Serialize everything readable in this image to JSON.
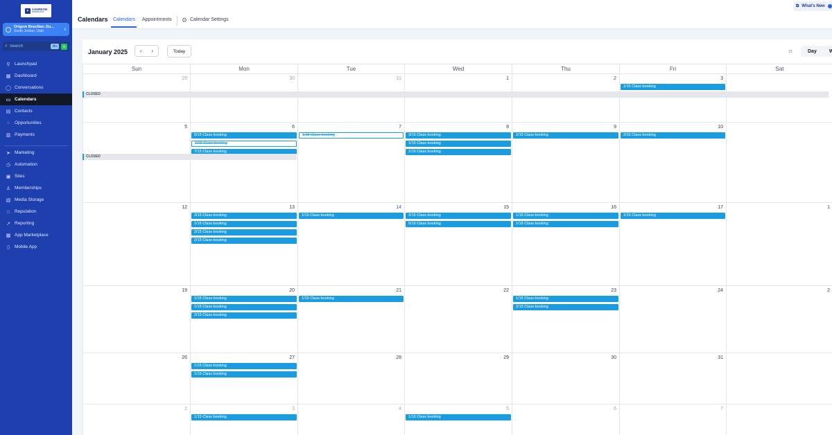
{
  "brand": {
    "logo_text": "AZUREON",
    "logo_sub": "MARKETING"
  },
  "location": {
    "name": "Origem Brazilian Jiu...",
    "city": "South Jordan, Utah"
  },
  "search": {
    "placeholder": "Search",
    "shortcut": "⌘K"
  },
  "nav_primary": [
    {
      "label": "Launchpad",
      "icon": "rocket-icon",
      "glyph": "⚲"
    },
    {
      "label": "Dashboard",
      "icon": "dashboard-icon",
      "glyph": "▦"
    },
    {
      "label": "Conversations",
      "icon": "chat-icon",
      "glyph": "◯"
    },
    {
      "label": "Calendars",
      "icon": "calendar-icon",
      "glyph": "▭",
      "active": true
    },
    {
      "label": "Contacts",
      "icon": "contacts-icon",
      "glyph": "▤"
    },
    {
      "label": "Opportunities",
      "icon": "opportunities-icon",
      "glyph": "⁘"
    },
    {
      "label": "Payments",
      "icon": "payments-icon",
      "glyph": "▥"
    }
  ],
  "nav_secondary": [
    {
      "label": "Marketing",
      "icon": "send-icon",
      "glyph": "➤"
    },
    {
      "label": "Automation",
      "icon": "automation-icon",
      "glyph": "◷"
    },
    {
      "label": "Sites",
      "icon": "sites-icon",
      "glyph": "▣"
    },
    {
      "label": "Memberships",
      "icon": "memberships-icon",
      "glyph": "♙"
    },
    {
      "label": "Media Storage",
      "icon": "media-icon",
      "glyph": "▧"
    },
    {
      "label": "Reputation",
      "icon": "reputation-icon",
      "glyph": "☆"
    },
    {
      "label": "Reporting",
      "icon": "reporting-icon",
      "glyph": "↗"
    },
    {
      "label": "App Marketplace",
      "icon": "marketplace-icon",
      "glyph": "▦"
    },
    {
      "label": "Mobile App",
      "icon": "mobile-icon",
      "glyph": "▯"
    }
  ],
  "header": {
    "title": "Calendars",
    "tabs": [
      "Calendars",
      "Appointments"
    ],
    "settings": "Calendar Settings",
    "whats_new": "What's New"
  },
  "calendar": {
    "month": "January 2025",
    "today_label": "Today",
    "views": [
      "Day",
      "W"
    ],
    "days_of_week": [
      "Sun",
      "Mon",
      "Tue",
      "Wed",
      "Thu",
      "Fri",
      "Sat"
    ],
    "closed_label": "CLOSED",
    "weeks": [
      {
        "days": [
          {
            "n": "29",
            "m": true,
            "ev": []
          },
          {
            "n": "30",
            "m": true,
            "ev": []
          },
          {
            "n": "31",
            "m": true,
            "ev": []
          },
          {
            "n": "1",
            "ev": []
          },
          {
            "n": "2",
            "ev": []
          },
          {
            "n": "3",
            "ev": [
              "1/15  Class booking"
            ]
          },
          {
            "n": "",
            "ev": []
          }
        ]
      },
      {
        "days": [
          {
            "n": "5",
            "ev": []
          },
          {
            "n": "6",
            "ev": [
              "5/15  Class booking",
              "~2/15  Class booking",
              "7/15  Class booking"
            ]
          },
          {
            "n": "7",
            "ev": [
              "~1/15  Class booking"
            ]
          },
          {
            "n": "8",
            "ev": [
              "3/15  Class booking",
              "1/15  Class booking",
              "1/15  Class booking"
            ]
          },
          {
            "n": "9",
            "ev": [
              "2/15  Class booking"
            ]
          },
          {
            "n": "10",
            "ev": [
              "2/15  Class booking"
            ]
          },
          {
            "n": "",
            "ev": []
          }
        ]
      },
      {
        "days": [
          {
            "n": "12",
            "ev": []
          },
          {
            "n": "13",
            "ev": [
              "2/15  Class booking",
              "1/15  Class booking",
              "2/15  Class booking",
              "2/15  Class booking"
            ]
          },
          {
            "n": "14",
            "t": true,
            "ev": [
              "1/15  Class booking"
            ]
          },
          {
            "n": "15",
            "ev": [
              "2/15  Class booking",
              "5/15  Class booking"
            ]
          },
          {
            "n": "16",
            "ev": [
              "1/15  Class booking",
              "1/15  Class booking"
            ]
          },
          {
            "n": "17",
            "ev": [
              "1/15  Class booking"
            ]
          },
          {
            "n": "1",
            "ev": []
          }
        ]
      },
      {
        "days": [
          {
            "n": "19",
            "ev": []
          },
          {
            "n": "20",
            "ev": [
              "1/15  Class booking",
              "1/15  Class booking",
              "2/15  Class booking"
            ]
          },
          {
            "n": "21",
            "ev": [
              "1/15  Class booking"
            ]
          },
          {
            "n": "22",
            "ev": []
          },
          {
            "n": "23",
            "ev": [
              "1/15  Class booking",
              "2/15  Class booking"
            ]
          },
          {
            "n": "24",
            "ev": []
          },
          {
            "n": "2",
            "ev": []
          }
        ]
      },
      {
        "days": [
          {
            "n": "26",
            "ev": []
          },
          {
            "n": "27",
            "ev": [
              "1/15  Class booking",
              "1/15  Class booking"
            ]
          },
          {
            "n": "28",
            "ev": []
          },
          {
            "n": "29",
            "ev": []
          },
          {
            "n": "30",
            "ev": []
          },
          {
            "n": "31",
            "ev": []
          },
          {
            "n": "",
            "ev": []
          }
        ]
      },
      {
        "days": [
          {
            "n": "2",
            "m": true,
            "ev": []
          },
          {
            "n": "3",
            "m": true,
            "ev": [
              "1/15  Class booking"
            ]
          },
          {
            "n": "4",
            "m": true,
            "ev": []
          },
          {
            "n": "5",
            "m": true,
            "ev": [
              "1/15  Class booking"
            ]
          },
          {
            "n": "6",
            "m": true,
            "ev": []
          },
          {
            "n": "7",
            "m": true,
            "ev": []
          },
          {
            "n": "",
            "ev": []
          }
        ]
      }
    ]
  },
  "colors": {
    "sidebar": "#1e40af",
    "event": "#1a9de0",
    "active_nav": "#111827",
    "accent": "#2563eb"
  }
}
